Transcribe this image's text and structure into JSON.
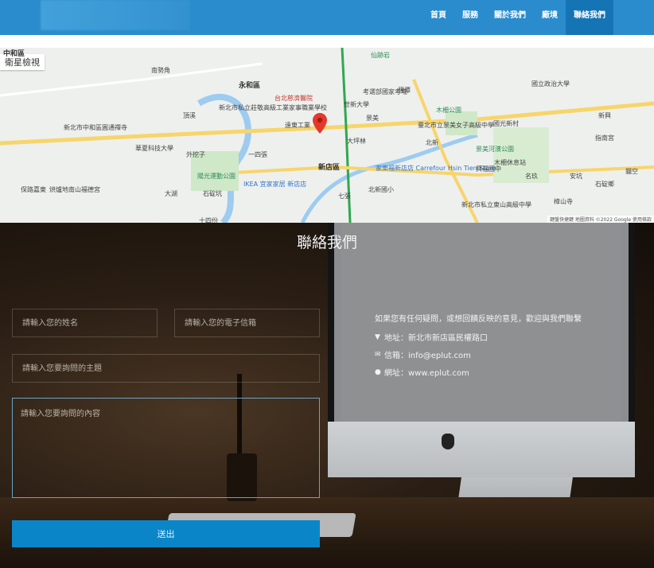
{
  "header": {
    "nav": [
      "首頁",
      "服務",
      "關於我們",
      "廠境",
      "聯絡我們"
    ],
    "active_index": 4
  },
  "map": {
    "satellite_label": "衛星檢視",
    "labels": [
      "中和區",
      "南勢角",
      "頂溪",
      "永和區",
      "台北慈濟醫院",
      "新北市私立莊敬高級工業家事職業學校",
      "遠東工業",
      "世新大學",
      "景美",
      "考選部國家考場",
      "仙跡岩",
      "木柵公園",
      "國立政治大學",
      "華夏科技大學",
      "外挖子",
      "一四張",
      "新北市中和區圓通禪寺",
      "新店區",
      "家樂福新店店 Carrefour Hsin Tien Store",
      "IKEA 宜家家居 新店店",
      "碧潭",
      "國光新村",
      "新興",
      "指南宮",
      "大湖",
      "石碇鄉",
      "安坑",
      "石碇坑",
      "七張",
      "北新國小",
      "臺北市立景美女子高級中學",
      "北新",
      "新北市私立東山高級中學",
      "樟山寺",
      "十四份",
      "大坪林",
      "陽光運動公園",
      "烘爐地南山福德宮",
      "名玖",
      "木柵休息站",
      "景美河濱公園",
      "貓空",
      "保路嘉東",
      "興福國中"
    ],
    "footer": "鍵盤快捷鍵  地圖資料 ©2022 Google  使用條款"
  },
  "contact": {
    "title": "聯絡我們",
    "placeholders": {
      "name": "請輸入您的姓名",
      "email": "請輸入您的電子信箱",
      "subject": "請輸入您要詢問的主題",
      "message": "請輸入您要詢問的內容"
    },
    "submit_label": "送出",
    "intro": "如果您有任何疑問，或想回饋反映的意見，歡迎與我們聯繫",
    "address": "地址：新北市新店區民權路口",
    "email": "信箱：info@eplut.com",
    "website": "網址：www.eplut.com"
  },
  "icons": [
    "map-marker-icon",
    "envelope-icon",
    "globe-icon"
  ],
  "colors": {
    "brand": "#2a8ccc",
    "active_nav": "#1474b4",
    "button": "#0a86c8"
  }
}
